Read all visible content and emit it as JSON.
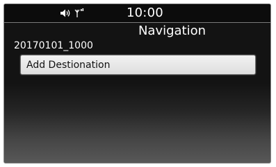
{
  "status_bar": {
    "time": "10:00",
    "icons": [
      "volume-icon",
      "phone-signal-icon"
    ]
  },
  "screen": {
    "title": "Navigation",
    "route_name": "20170101_1000"
  },
  "menu": {
    "items": [
      {
        "label": "Add Destionation"
      }
    ]
  },
  "colors": {
    "background": "#131313",
    "text": "#ffffff",
    "button_face": "#e6e6e6",
    "button_text": "#111111"
  }
}
